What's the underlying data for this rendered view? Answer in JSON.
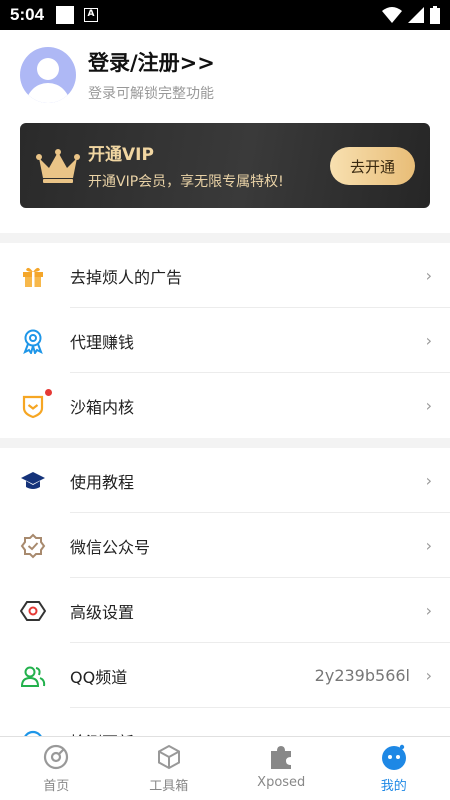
{
  "status_bar": {
    "time": "5:04",
    "badge": "A"
  },
  "profile": {
    "title": "登录/注册>>",
    "subtitle": "登录可解锁完整功能"
  },
  "vip": {
    "title": "开通VIP",
    "subtitle": "开通VIP会员，享无限专属特权!",
    "button": "去开通"
  },
  "menu": [
    {
      "label": "去掉烦人的广告",
      "icon": "gift-icon",
      "value": ""
    },
    {
      "label": "代理赚钱",
      "icon": "award-icon",
      "value": ""
    },
    {
      "label": "沙箱内核",
      "icon": "shield-icon",
      "value": ""
    },
    {
      "label": "使用教程",
      "icon": "graduation-cap-icon",
      "value": ""
    },
    {
      "label": "微信公众号",
      "icon": "badge-check-icon",
      "value": ""
    },
    {
      "label": "高级设置",
      "icon": "settings-hexagon-icon",
      "value": ""
    },
    {
      "label": "QQ频道",
      "icon": "users-icon",
      "value": "2y239b566l"
    },
    {
      "label": "检测更新",
      "icon": "refresh-icon",
      "value": ""
    }
  ],
  "arrow": "›",
  "tabs": [
    {
      "label": "首页",
      "icon": "home-disc-icon"
    },
    {
      "label": "工具箱",
      "icon": "cube-icon"
    },
    {
      "label": "Xposed",
      "icon": "puzzle-icon"
    },
    {
      "label": "我的",
      "icon": "profile-bot-icon"
    }
  ],
  "colors": {
    "accent": "#1e88e5",
    "vip_gold": "#e8bd77",
    "vip_bg": "#2f2f2f"
  }
}
